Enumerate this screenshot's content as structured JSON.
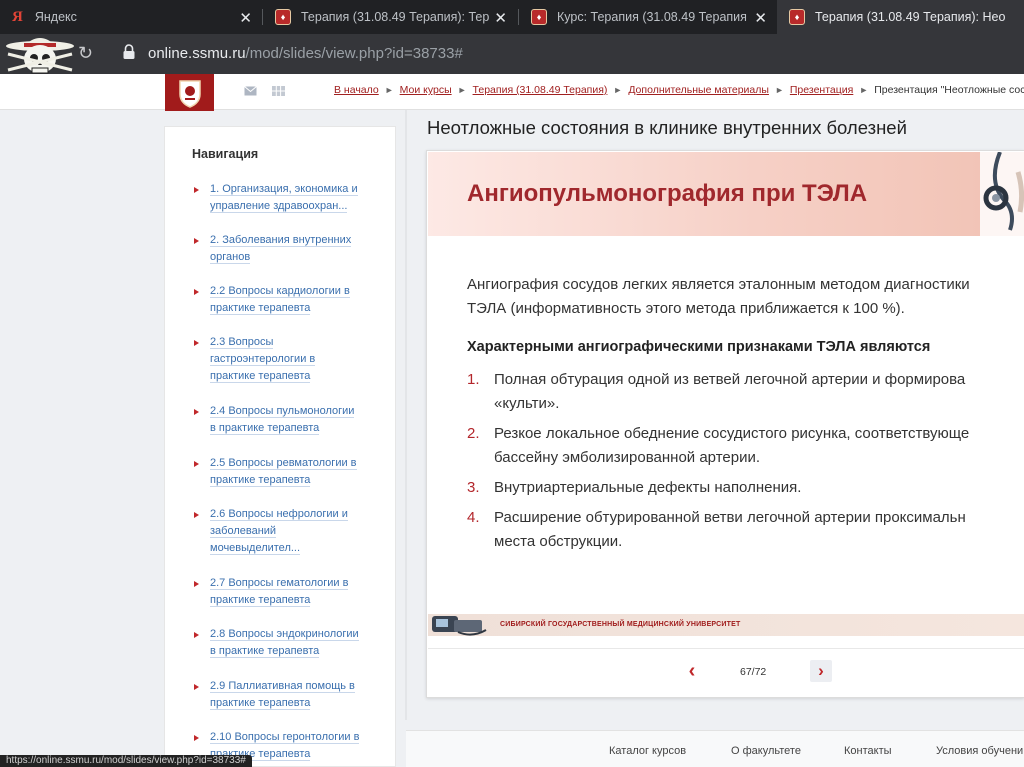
{
  "browser": {
    "tabs": [
      {
        "title": "Яндекс",
        "favicon": "yandex-icon",
        "active": false
      },
      {
        "title": "Терапия (31.08.49 Терапия): Тер",
        "favicon": "crest-icon",
        "active": false
      },
      {
        "title": "Курс: Терапия (31.08.49 Терапия",
        "favicon": "crest-icon",
        "active": false
      },
      {
        "title": "Терапия (31.08.49 Терапия): Нео",
        "favicon": "crest-icon",
        "active": true
      }
    ],
    "url_host": "online.ssmu.ru",
    "url_path": "/mod/slides/view.php?id=38733#",
    "status_url": "https://online.ssmu.ru/mod/slides/view.php?id=38733#"
  },
  "breadcrumb": [
    {
      "label": "В начало",
      "link": true
    },
    {
      "label": "Мои курсы",
      "link": true
    },
    {
      "label": "Терапия (31.08.49 Терапия)",
      "link": true
    },
    {
      "label": "Дополнительные материалы",
      "link": true
    },
    {
      "label": "Презентация",
      "link": true
    },
    {
      "label": "Презентация \"Неотложные состоя-",
      "link": false
    }
  ],
  "sidebar": {
    "title": "Навигация",
    "items": [
      {
        "lines": [
          "1. Организация, экономика и",
          "управление здравоохран..."
        ]
      },
      {
        "lines": [
          "2. Заболевания внутренних",
          "органов"
        ]
      },
      {
        "lines": [
          "2.2 Вопросы кардиологии в",
          "практике терапевта"
        ]
      },
      {
        "lines": [
          "2.3 Вопросы",
          "гастроэнтерологии в",
          "практике терапевта"
        ]
      },
      {
        "lines": [
          "2.4 Вопросы пульмонологии",
          "в практике терапевта"
        ]
      },
      {
        "lines": [
          "2.5 Вопросы ревматологии в",
          "практике терапевта"
        ]
      },
      {
        "lines": [
          "2.6 Вопросы нефрологии и",
          "заболеваний",
          "мочевыделител..."
        ]
      },
      {
        "lines": [
          "2.7 Вопросы гематологии в",
          "практике терапевта"
        ]
      },
      {
        "lines": [
          "2.8 Вопросы эндокринологии",
          "в практике терапевта"
        ]
      },
      {
        "lines": [
          "2.9 Паллиативная помощь в",
          "практике терапевта"
        ]
      },
      {
        "lines": [
          "2.10 Вопросы геронтологии в",
          "практике терапевта"
        ]
      }
    ]
  },
  "main": {
    "title": "Неотложные состояния в клинике внутренних болезней",
    "slide": {
      "title": "Ангиопульмонография при ТЭЛА",
      "paragraph_lines": [
        "Ангиография сосудов легких является эталонным методом диагностики",
        "ТЭЛА (информативность этого метода приближается к 100 %)."
      ],
      "list_heading": "Характерными ангиографическими признаками ТЭЛА являются",
      "list": [
        {
          "num": "1.",
          "lines": [
            "Полная обтурация одной из ветвей легочной артерии и формирова",
            "«культи»."
          ]
        },
        {
          "num": "2.",
          "lines": [
            "Резкое локальное обеднение сосудистого рисунка, соответствующе",
            "бассейну эмболизированной артерии."
          ]
        },
        {
          "num": "3.",
          "lines": [
            "Внутриартериальные дефекты наполнения."
          ]
        },
        {
          "num": "4.",
          "lines": [
            "Расширение обтурированной ветви легочной артерии проксимальн",
            "места обструкции."
          ]
        }
      ],
      "footer_org": "СИБИРСКИЙ ГОСУДАРСТВЕННЫЙ МЕДИЦИНСКИЙ УНИВЕРСИТЕТ"
    },
    "pager": {
      "current": 67,
      "total": 72,
      "label": "67/72",
      "prev_symbol": "‹",
      "next_symbol": "›"
    }
  },
  "footer": {
    "links": [
      "Каталог курсов",
      "О факультете",
      "Контакты",
      "Условия обучени"
    ]
  },
  "colors": {
    "accent": "#a12020",
    "link": "#3a6fae",
    "slide_title": "#a0282d"
  }
}
